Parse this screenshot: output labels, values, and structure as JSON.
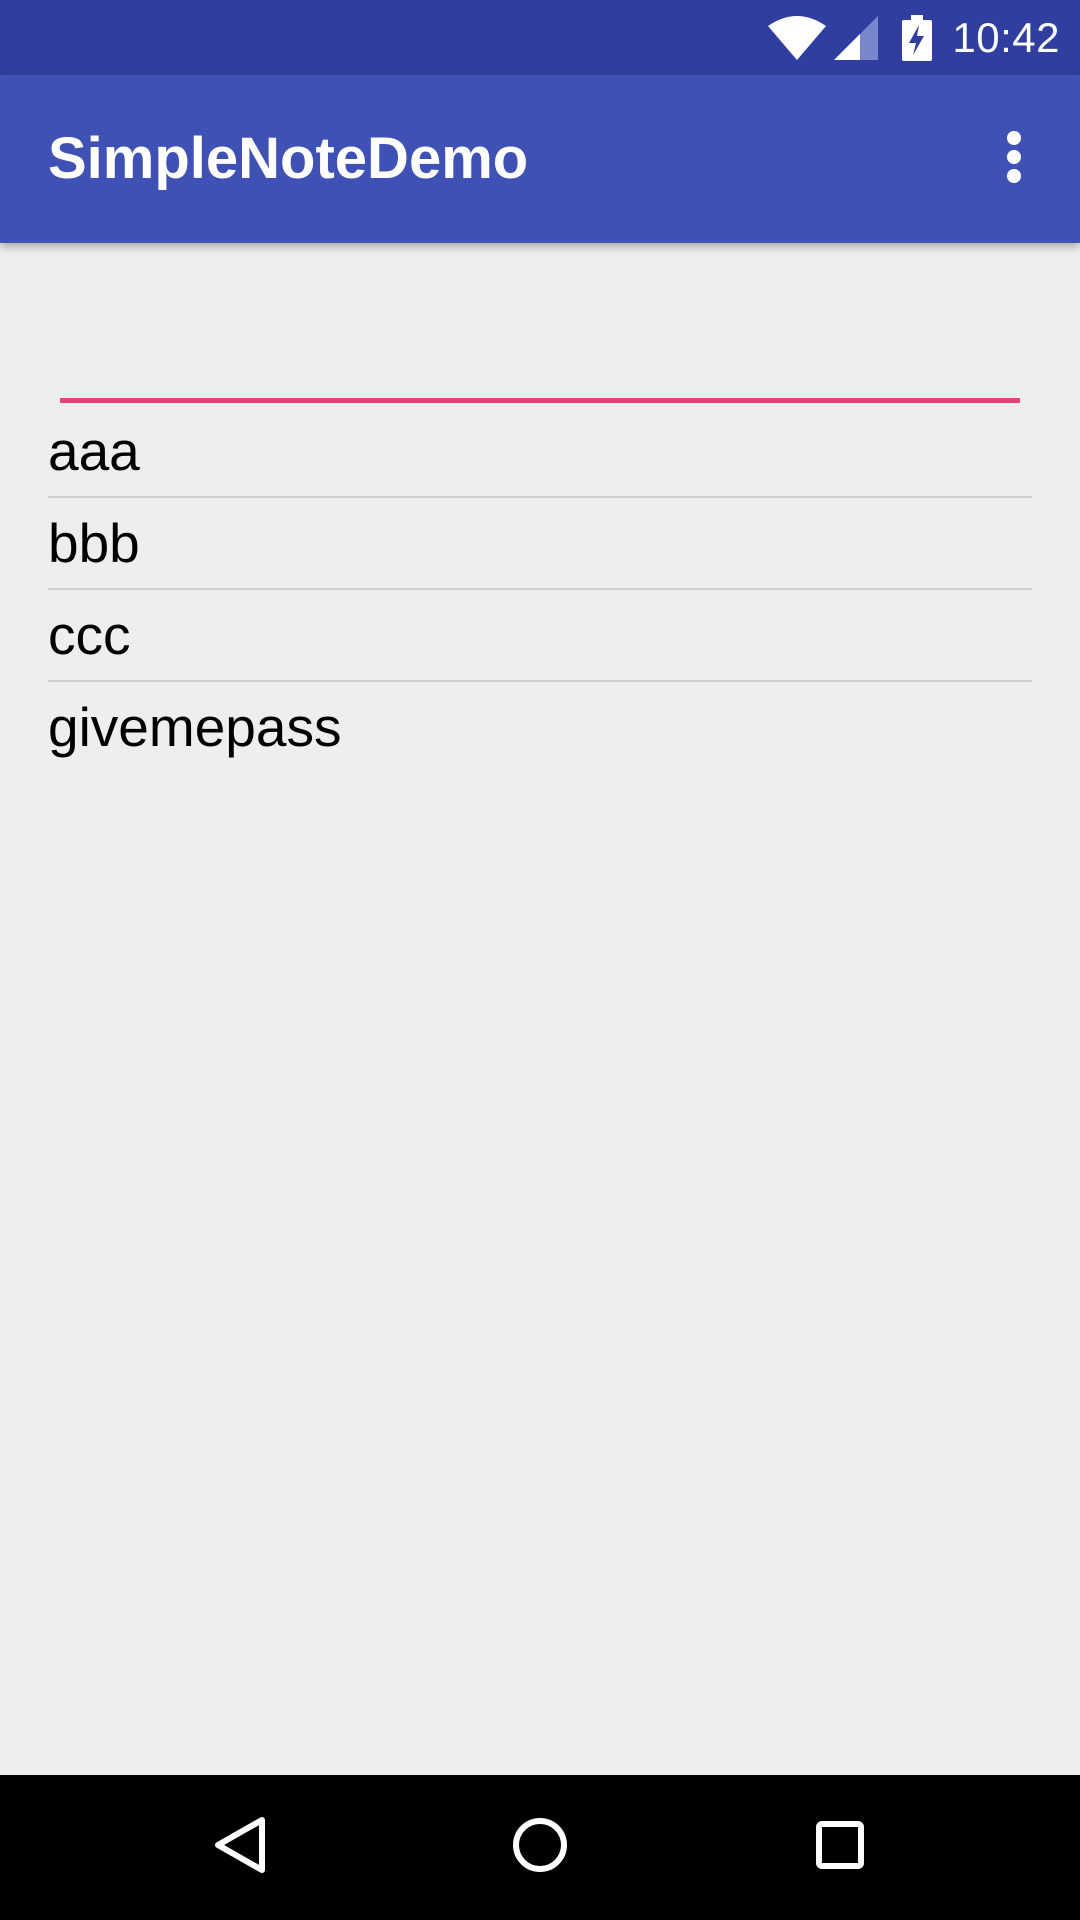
{
  "status_bar": {
    "time": "10:42",
    "icons": [
      "wifi-icon",
      "signal-icon",
      "battery-charging-icon"
    ]
  },
  "app_bar": {
    "title": "SimpleNoteDemo",
    "menu_icon": "more-vert-icon"
  },
  "note_input": {
    "value": "",
    "placeholder": ""
  },
  "notes": [
    {
      "text": "aaa"
    },
    {
      "text": "bbb"
    },
    {
      "text": "ccc"
    },
    {
      "text": "givemepass"
    }
  ],
  "nav_bar": {
    "icons": [
      "back-icon",
      "home-icon",
      "recents-icon"
    ]
  },
  "colors": {
    "status_bar": "#303f9f",
    "app_bar": "#3f51b5",
    "accent": "#ec407a",
    "background": "#eeeeee",
    "nav_bar": "#000000"
  }
}
